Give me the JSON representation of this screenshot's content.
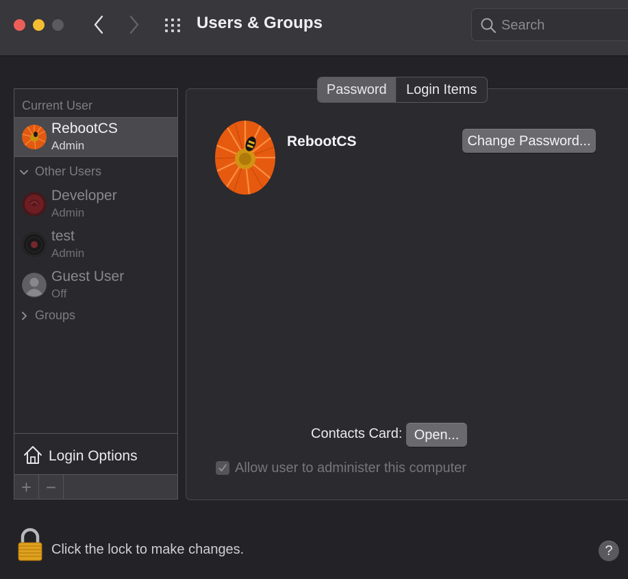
{
  "window": {
    "title": "Users & Groups",
    "search_placeholder": "Search"
  },
  "sidebar": {
    "current_user_label": "Current User",
    "current_user": {
      "name": "RebootCS",
      "role": "Admin"
    },
    "other_users_label": "Other Users",
    "other_users": [
      {
        "name": "Developer",
        "role": "Admin",
        "avatar": "rose"
      },
      {
        "name": "test",
        "role": "Admin",
        "avatar": "vinyl"
      },
      {
        "name": "Guest User",
        "role": "Off",
        "avatar": "guest-silhouette"
      }
    ],
    "groups_label": "Groups",
    "login_options_label": "Login Options",
    "add_label": "+",
    "remove_label": "−"
  },
  "tabs": [
    {
      "label": "Password",
      "selected": true
    },
    {
      "label": "Login Items",
      "selected": false
    }
  ],
  "profile": {
    "name": "RebootCS",
    "change_password_label": "Change Password...",
    "contacts_card_label": "Contacts Card:",
    "open_label": "Open...",
    "allow_admin_label": "Allow user to administer this computer",
    "allow_admin_checked": true
  },
  "footer": {
    "lock_text": "Click the lock to make changes.",
    "help_label": "?"
  },
  "colors": {
    "accent_orange": "#f26a1b",
    "close": "#ee5e58",
    "minimize": "#f4bd32"
  }
}
